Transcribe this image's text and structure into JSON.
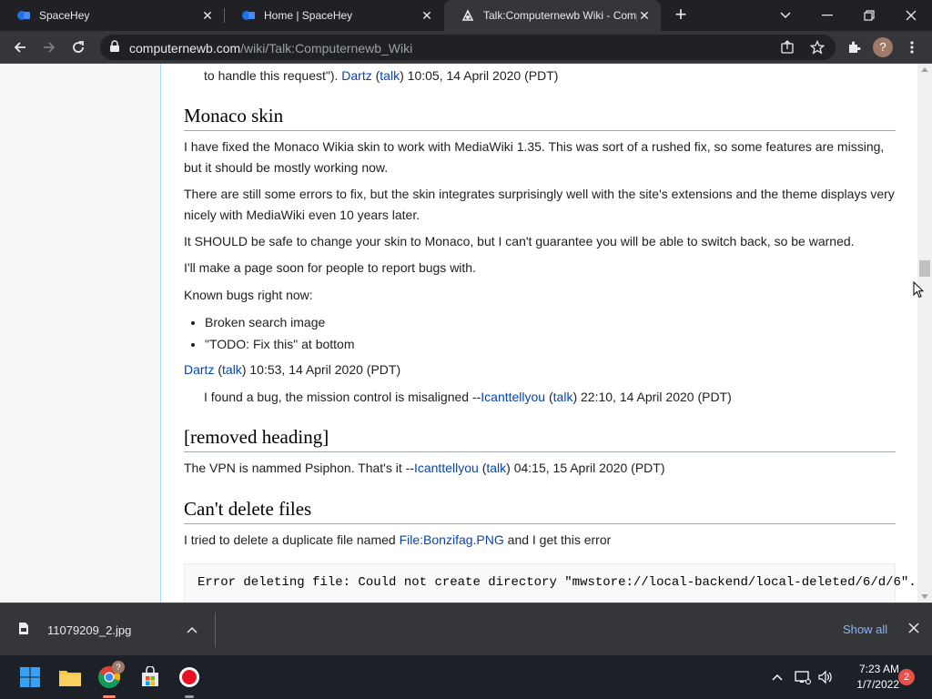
{
  "browser": {
    "tabs": [
      {
        "title": "SpaceHey"
      },
      {
        "title": "Home | SpaceHey"
      },
      {
        "title": "Talk:Computernewb Wiki - Comp"
      }
    ],
    "url_host": "computernewb.com",
    "url_path": "/wiki/Talk:Computernewb_Wiki",
    "profile_initial": "?"
  },
  "page": {
    "prev_tail": {
      "text": "to handle this request\").",
      "user": "Dartz",
      "talk": "talk",
      "time": "10:05, 14 April 2020 (PDT)"
    },
    "sec1": {
      "heading": "Monaco skin",
      "p1a": "I have fixed the Monaco Wikia skin to work with MediaWiki 1.35. This was sort of a rushed fix, so some features are missing,",
      "p1b": "but it should be mostly working now.",
      "p2a": "There are still some errors to fix, but the skin integrates surprisingly well with the site's extensions and the theme displays very",
      "p2b": "nicely with MediaWiki even 10 years later.",
      "p3": "It SHOULD be safe to change your skin to Monaco, but I can't guarantee you will be able to switch back, so be warned.",
      "p4": "I'll make a page soon for people to report bugs with.",
      "p5": "Known bugs right now:",
      "bugs": [
        "Broken search image",
        "\"TODO: Fix this\" at bottom"
      ],
      "sig_user": "Dartz",
      "sig_talk": "talk",
      "sig_time": "10:53, 14 April 2020 (PDT)",
      "reply_text": "I found a bug, the mission control is misaligned --",
      "reply_user": "Icanttellyou",
      "reply_talk": "talk",
      "reply_time": "22:10, 14 April 2020 (PDT)"
    },
    "sec2": {
      "heading": "[removed heading]",
      "text": "The VPN is nammed Psiphon. That's it --",
      "user": "Icanttellyou",
      "talk": "talk",
      "time": "04:15, 15 April 2020 (PDT)"
    },
    "sec3": {
      "heading": "Can't delete files",
      "text_a": "I tried to delete a duplicate file named",
      "file_link": "File:Bonzifag.PNG",
      "text_b": "and I get this error",
      "code": "Error deleting file: Could not create directory \"mwstore://local-backend/local-deleted/6/d/6\"."
    }
  },
  "downloads": {
    "filename": "11079209_2.jpg",
    "show_all": "Show all"
  },
  "taskbar": {
    "time": "7:23 AM",
    "date": "1/7/2022",
    "notifications": "2",
    "chrome_badge": "?"
  },
  "colors": {
    "link": "#0645ad",
    "chrome_dark": "#202124",
    "chrome_toolbar": "#35363a",
    "show_all": "#8ab4f8"
  }
}
